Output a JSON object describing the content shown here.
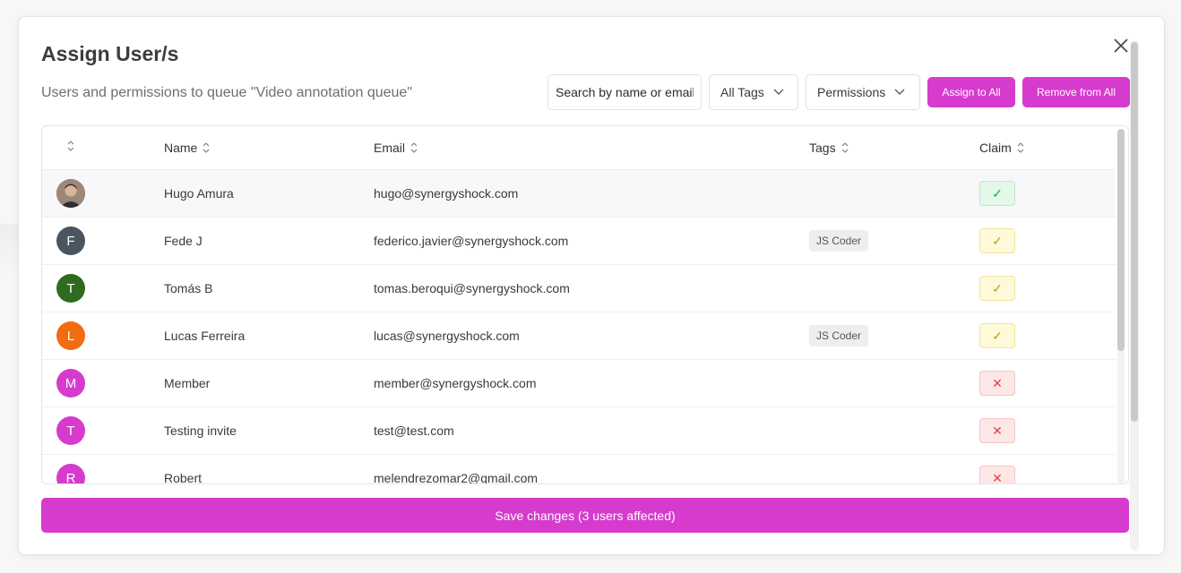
{
  "modal": {
    "title": "Assign User/s",
    "subtitle": "Users and permissions to queue \"Video annotation queue\"",
    "close_icon": "close-icon"
  },
  "toolbar": {
    "search_placeholder": "Search by name or email",
    "tags_filter": "All Tags",
    "permissions_filter": "Permissions",
    "assign_all_label": "Assign to All",
    "remove_all_label": "Remove from All"
  },
  "table": {
    "headers": {
      "avatar": "",
      "name": "Name",
      "email": "Email",
      "tags": "Tags",
      "claim": "Claim"
    },
    "rows": [
      {
        "initial": "",
        "avatar_color": "#8a6f5e",
        "name": "Hugo Amura",
        "email": "hugo@synergyshock.com",
        "tag": "",
        "claim": "green",
        "claim_symbol": "✓"
      },
      {
        "initial": "F",
        "avatar_color": "#4a5560",
        "name": "Fede J",
        "email": "federico.javier@synergyshock.com",
        "tag": "JS Coder",
        "claim": "yellow",
        "claim_symbol": "✓"
      },
      {
        "initial": "T",
        "avatar_color": "#2f6b1f",
        "name": "Tomás B",
        "email": "tomas.beroqui@synergyshock.com",
        "tag": "",
        "claim": "yellow",
        "claim_symbol": "✓"
      },
      {
        "initial": "L",
        "avatar_color": "#f26c11",
        "name": "Lucas Ferreira",
        "email": "lucas@synergyshock.com",
        "tag": "JS Coder",
        "claim": "yellow",
        "claim_symbol": "✓"
      },
      {
        "initial": "M",
        "avatar_color": "#d63bcd",
        "name": "Member",
        "email": "member@synergyshock.com",
        "tag": "",
        "claim": "red",
        "claim_symbol": "✕"
      },
      {
        "initial": "T",
        "avatar_color": "#d63bcd",
        "name": "Testing invite",
        "email": "test@test.com",
        "tag": "",
        "claim": "red",
        "claim_symbol": "✕"
      },
      {
        "initial": "R",
        "avatar_color": "#d63bcd",
        "name": "Robert",
        "email": "melendrezomar2@gmail.com",
        "tag": "",
        "claim": "red",
        "claim_symbol": "✕"
      }
    ]
  },
  "footer": {
    "save_label": "Save changes (3 users affected)"
  },
  "colors": {
    "accent": "#d63bcd"
  }
}
